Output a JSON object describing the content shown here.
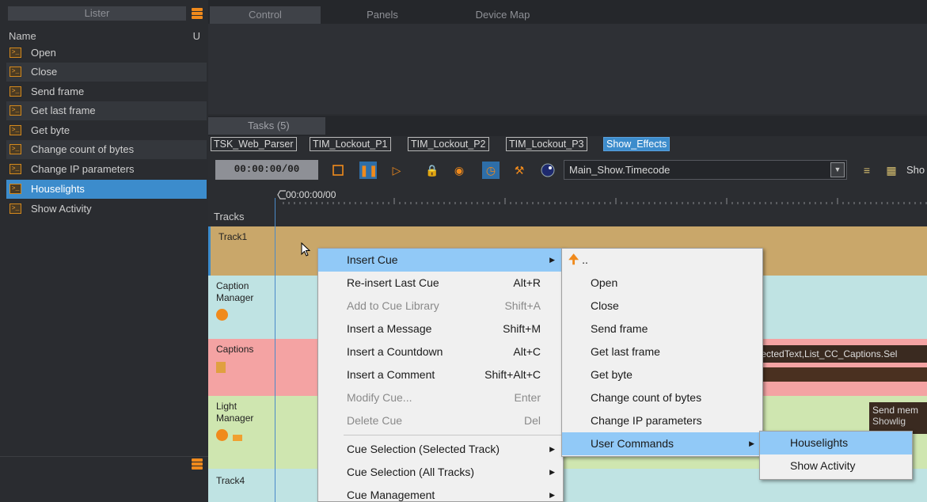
{
  "lister": {
    "tab_label": "Lister",
    "col_name": "Name",
    "col_u": "U",
    "items": [
      {
        "label": "Open"
      },
      {
        "label": "Close"
      },
      {
        "label": "Send frame"
      },
      {
        "label": "Get last frame"
      },
      {
        "label": "Get byte"
      },
      {
        "label": "Change count of bytes"
      },
      {
        "label": "Change IP parameters"
      },
      {
        "label": "Houselights"
      },
      {
        "label": "Show Activity"
      }
    ]
  },
  "top_tabs": [
    "Control",
    "Panels",
    "Device Map"
  ],
  "tasks": {
    "tab_label": "Tasks (5)",
    "task_tabs": [
      "TSK_Web_Parser",
      "TIM_Lockout_P1",
      "TIM_Lockout_P2",
      "TIM_Lockout_P3",
      "Show_Effects"
    ],
    "timecode": "00:00:00/00",
    "timecode_source": "Main_Show.Timecode",
    "show_label": "Sho",
    "ruler_start": "00:00:00/00",
    "tracks_header": "Tracks"
  },
  "tracks": [
    {
      "name": "Track1",
      "color": "#c9a76a"
    },
    {
      "name": "Caption Manager",
      "color": "#bfe3e3"
    },
    {
      "name": "Captions",
      "color": "#f4a3a3"
    },
    {
      "name": "Light Manager",
      "color": "#cfe6b0"
    },
    {
      "name": "Track4",
      "color": "#bfe3e3"
    }
  ],
  "cue_overlay_text": "electedText,List_CC_Captions.Sel",
  "light_overlay_text": "Send mem",
  "light_overlay_sub": "Showlig",
  "context_menu": [
    {
      "label": "Insert Cue",
      "shortcut": "",
      "highlighted": true,
      "submenu": true
    },
    {
      "label": "Re-insert Last Cue",
      "shortcut": "Alt+R"
    },
    {
      "label": "Add to Cue Library",
      "shortcut": "Shift+A",
      "disabled": true
    },
    {
      "label": "Insert a Message",
      "shortcut": "Shift+M"
    },
    {
      "label": "Insert a Countdown",
      "shortcut": "Alt+C"
    },
    {
      "label": "Insert a Comment",
      "shortcut": "Shift+Alt+C"
    },
    {
      "label": "Modify Cue...",
      "shortcut": "Enter",
      "disabled": true
    },
    {
      "label": "Delete Cue",
      "shortcut": "Del",
      "disabled": true
    },
    {
      "label": "Cue Selection (Selected Track)",
      "submenu": true
    },
    {
      "label": "Cue Selection (All Tracks)",
      "submenu": true
    },
    {
      "label": "Cue Management",
      "submenu": true
    }
  ],
  "submenu_1": {
    "up_label": "..",
    "items": [
      "Open",
      "Close",
      "Send frame",
      "Get last frame",
      "Get byte",
      "Change count of bytes",
      "Change IP parameters",
      "User Commands"
    ]
  },
  "submenu_2": {
    "items": [
      "Houselights",
      "Show Activity"
    ]
  },
  "colors": {
    "accent_orange": "#f08a1c",
    "selection_blue": "#3c8ccc",
    "menu_highlight": "#91c9f7"
  }
}
